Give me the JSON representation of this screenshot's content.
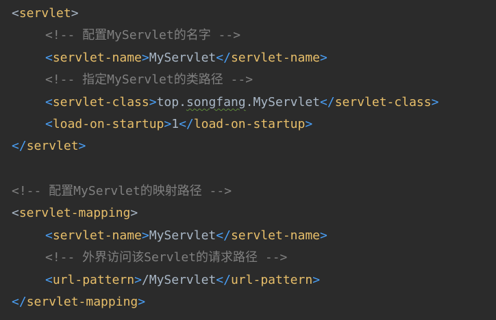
{
  "colors": {
    "background": "#2b2b2b",
    "tag": "#e8bf6a",
    "bracket": "#4a9ff5",
    "text": "#a9b7c6",
    "comment": "#808080"
  },
  "lines": [
    {
      "open": "<",
      "tag": "servlet",
      "close": ">"
    },
    {
      "comment": "<!-- 配置MyServlet的名字 -->"
    },
    {
      "tag": "servlet-name",
      "text": "MyServlet",
      "end_tag": "servlet-name"
    },
    {
      "comment": "<!-- 指定MyServlet的类路径 -->"
    },
    {
      "tag": "servlet-class",
      "text_a": "top.",
      "text_typo": "songfang",
      "text_b": ".MyServlet",
      "end_tag": "servlet-class"
    },
    {
      "tag": "load-on-startup",
      "text": "1",
      "end_tag": "load-on-startup"
    },
    {
      "end_tag": "servlet"
    },
    {},
    {
      "comment": "<!-- 配置MyServlet的映射路径 -->"
    },
    {
      "tag": "servlet-mapping"
    },
    {
      "tag": "servlet-name",
      "text": "MyServlet",
      "end_tag": "servlet-name"
    },
    {
      "comment": "<!-- 外界访问该Servlet的请求路径 -->"
    },
    {
      "tag": "url-pattern",
      "text": "/MyServlet",
      "end_tag": "url-pattern"
    },
    {
      "end_tag": "servlet-mapping"
    }
  ]
}
